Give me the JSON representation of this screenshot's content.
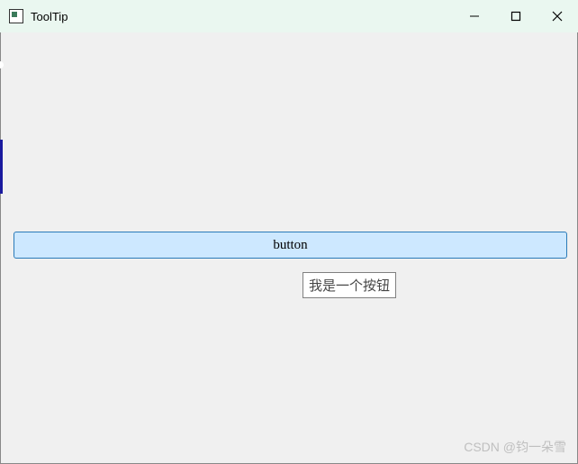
{
  "window": {
    "title": "ToolTip"
  },
  "content": {
    "button_label": "button",
    "tooltip_text": "我是一个按钮"
  },
  "watermark": {
    "text": "CSDN @钧一朵雪"
  }
}
